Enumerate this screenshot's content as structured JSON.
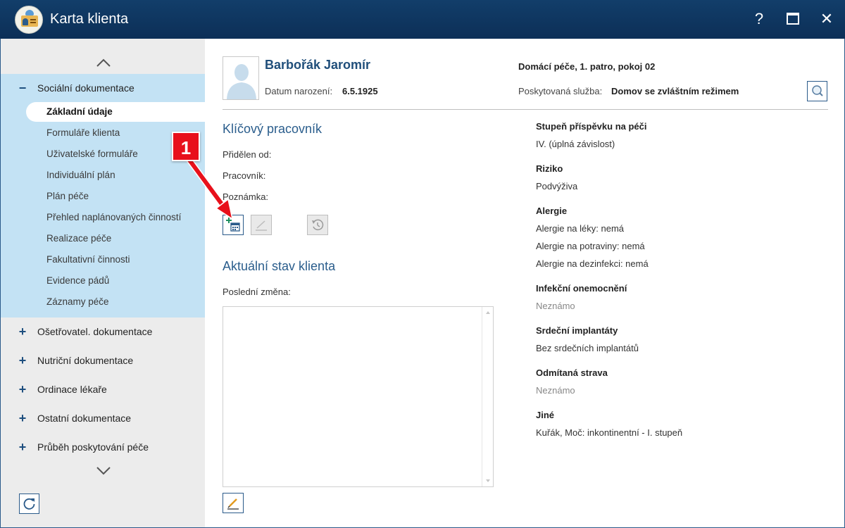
{
  "window": {
    "title": "Karta klienta",
    "help_glyph": "?",
    "close_glyph": "✕"
  },
  "sidebar": {
    "sections": [
      {
        "label": "Sociální dokumentace",
        "expanded": true,
        "sign": "−",
        "items": [
          {
            "label": "Základní údaje",
            "active": true
          },
          {
            "label": "Formuláře klienta"
          },
          {
            "label": "Uživatelské formuláře"
          },
          {
            "label": "Individuální plán"
          },
          {
            "label": "Plán péče"
          },
          {
            "label": "Přehled naplánovaných činností"
          },
          {
            "label": "Realizace péče"
          },
          {
            "label": "Fakultativní činnosti"
          },
          {
            "label": "Evidence pádů"
          },
          {
            "label": "Záznamy péče"
          }
        ]
      },
      {
        "label": "Ošetřovatel. dokumentace",
        "sign": "+"
      },
      {
        "label": "Nutriční dokumentace",
        "sign": "+"
      },
      {
        "label": "Ordinace lékaře",
        "sign": "+"
      },
      {
        "label": "Ostatní dokumentace",
        "sign": "+"
      },
      {
        "label": "Průběh poskytování péče",
        "sign": "+"
      }
    ],
    "icons": {
      "scroll_up": "chevron-up-icon",
      "scroll_down": "chevron-down-icon",
      "refresh": "refresh-icon"
    }
  },
  "client": {
    "name": "Barbořák Jaromír",
    "birth_label": "Datum narození:",
    "birth_value": "6.5.1925",
    "location": "Domácí péče, 1. patro, pokoj 02",
    "service_label": "Poskytovaná služba:",
    "service_value": "Domov se zvláštním režimem"
  },
  "key_worker": {
    "heading": "Klíčový pracovník",
    "assigned_from_label": "Přidělen od:",
    "worker_label": "Pracovník:",
    "note_label": "Poznámka:"
  },
  "current_state": {
    "heading": "Aktuální stav klienta",
    "last_change_label": "Poslední změna:"
  },
  "info": [
    {
      "title": "Stupeň příspěvku na péči",
      "values": [
        "IV. (úplná závislost)"
      ]
    },
    {
      "title": "Riziko",
      "values": [
        "Podvýživa"
      ]
    },
    {
      "title": "Alergie",
      "values": [
        "Alergie na léky: nemá",
        "Alergie na potraviny: nemá",
        "Alergie na dezinfekci: nemá"
      ]
    },
    {
      "title": "Infekční onemocnění",
      "values": [
        "Neznámo"
      ],
      "muted": true
    },
    {
      "title": "Srdeční implantáty",
      "values": [
        "Bez srdečních implantátů"
      ]
    },
    {
      "title": "Odmítaná strava",
      "values": [
        "Neznámo"
      ],
      "muted": true
    },
    {
      "title": "Jiné",
      "values": [
        "Kuřák, Moč: inkontinentní - I. stupeň"
      ]
    }
  ],
  "annotation": {
    "number": "1"
  },
  "colors": {
    "titlebar": "#0c2f57",
    "accent": "#1f4e7a",
    "sidebar_active_section": "#c3e2f4",
    "sidebar_bg": "#ececec",
    "callout": "#e8101b"
  }
}
